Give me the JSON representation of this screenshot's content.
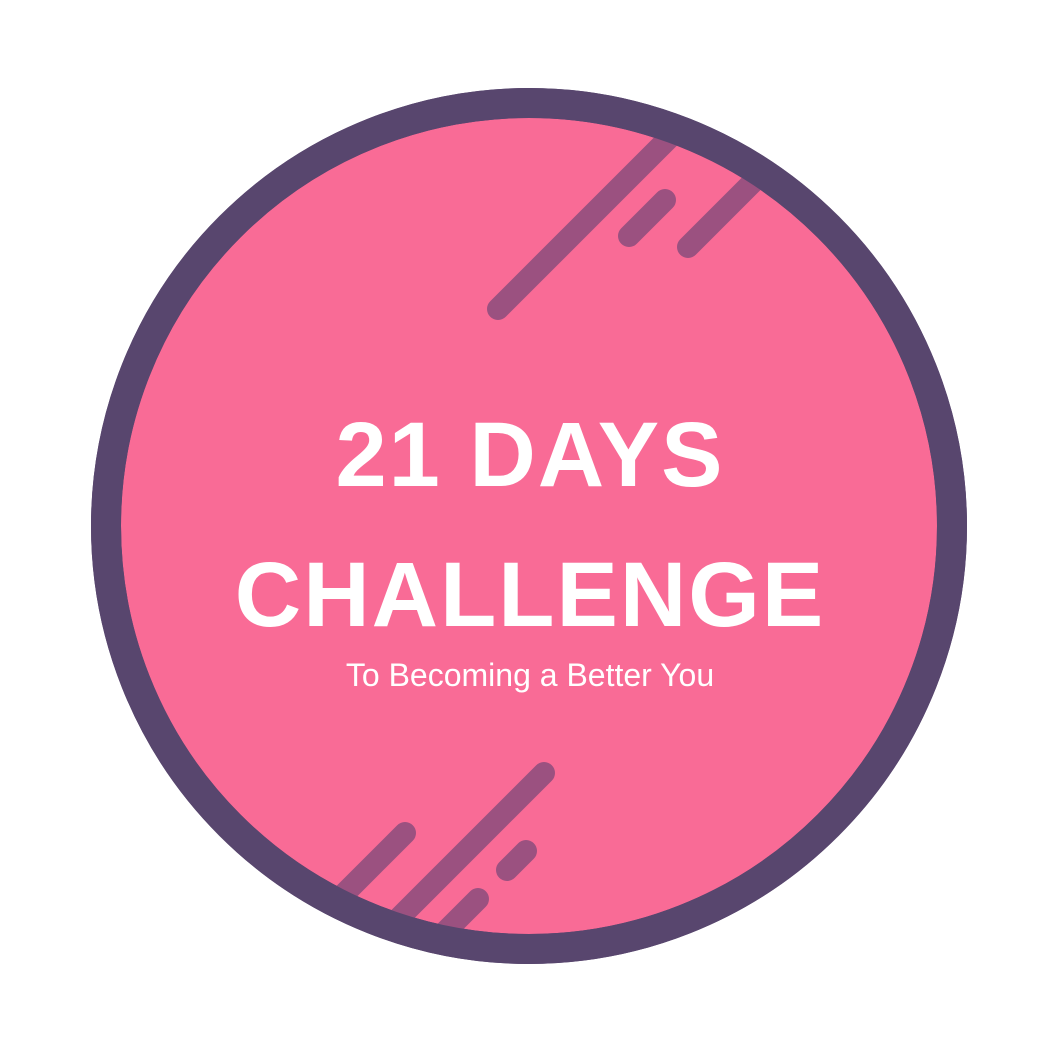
{
  "badge": {
    "title_line_1": "21 DAYS",
    "title_line_2": "CHALLENGE",
    "subtitle": "To Becoming a Better You"
  },
  "colors": {
    "circle_fill": "#f96b96",
    "ring": "#58466e",
    "stripes": "#9b5180",
    "text": "#ffffff",
    "background": "#ffffff"
  },
  "icons": {
    "top_stripes": "diagonal-stripes-icon",
    "bottom_stripes": "diagonal-stripes-icon"
  }
}
